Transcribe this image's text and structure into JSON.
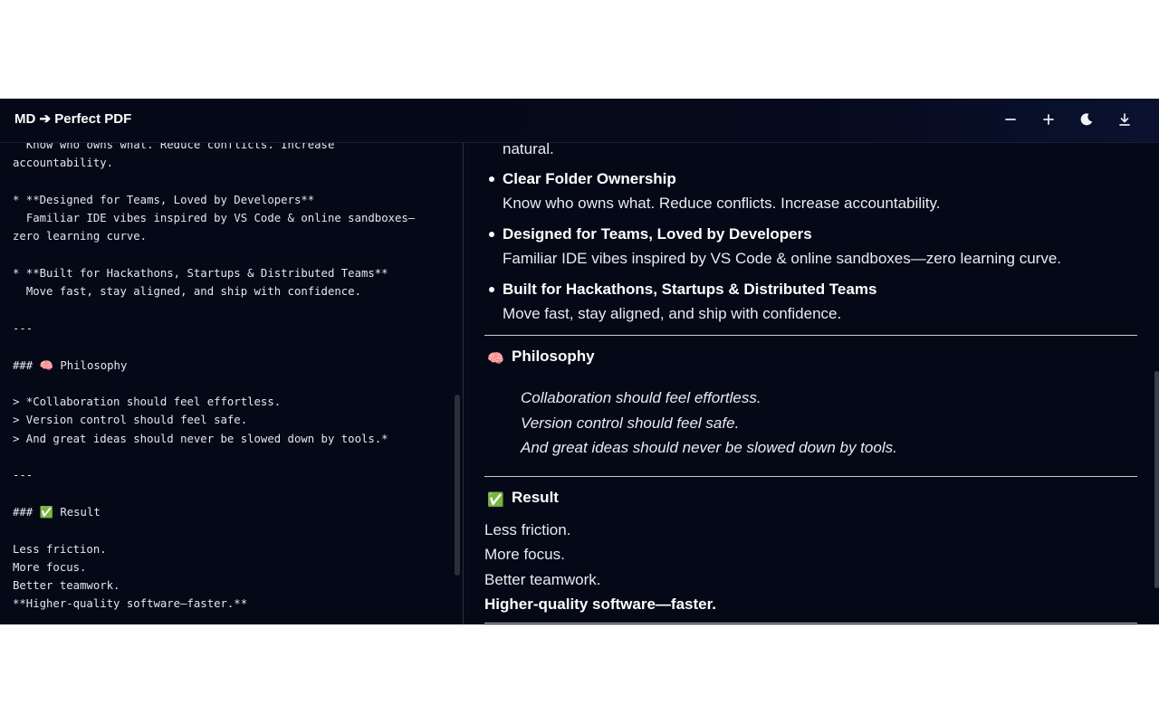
{
  "header": {
    "title": "MD ➔ Perfect PDF",
    "buttons": [
      {
        "name": "zoom-out-button",
        "icon": "minus-icon"
      },
      {
        "name": "zoom-in-button",
        "icon": "plus-icon"
      },
      {
        "name": "theme-toggle-button",
        "icon": "moon-icon"
      },
      {
        "name": "download-button",
        "icon": "download-icon"
      }
    ]
  },
  "editor": {
    "content": "  Know who owns what. Reduce conflicts. Increase\naccountability.\n\n* **Designed for Teams, Loved by Developers**\n  Familiar IDE vibes inspired by VS Code & online sandboxes—\nzero learning curve.\n\n* **Built for Hackathons, Startups & Distributed Teams**\n  Move fast, stay aligned, and ship with confidence.\n\n---\n\n### 🧠 Philosophy\n\n> *Collaboration should feel effortless.\n> Version control should feel safe.\n> And great ideas should never be slowed down by tools.*\n\n---\n\n### ✅ Result\n\nLess friction.\nMore focus.\nBetter teamwork.\n**Higher-quality software—faster.**"
  },
  "preview": {
    "fragment": "natural.",
    "features": [
      {
        "title": "Clear Folder Ownership",
        "desc": "Know who owns what. Reduce conflicts. Increase accountability."
      },
      {
        "title": "Designed for Teams, Loved by Developers",
        "desc": "Familiar IDE vibes inspired by VS Code & online sandboxes—zero learning curve."
      },
      {
        "title": "Built for Hackathons, Startups & Distributed Teams",
        "desc": "Move fast, stay aligned, and ship with confidence."
      }
    ],
    "philosophy": {
      "emoji": "🧠",
      "heading": "Philosophy",
      "quote": [
        "Collaboration should feel effortless.",
        "Version control should feel safe.",
        "And great ideas should never be slowed down by tools."
      ]
    },
    "result": {
      "emoji": "✅",
      "heading": "Result",
      "lines": [
        "Less friction.",
        "More focus.",
        "Better teamwork."
      ],
      "bold_line": "Higher-quality software—faster."
    }
  },
  "colors": {
    "background": "#050816",
    "text": "#e8ebf2",
    "divider": "#c9ccd4"
  }
}
